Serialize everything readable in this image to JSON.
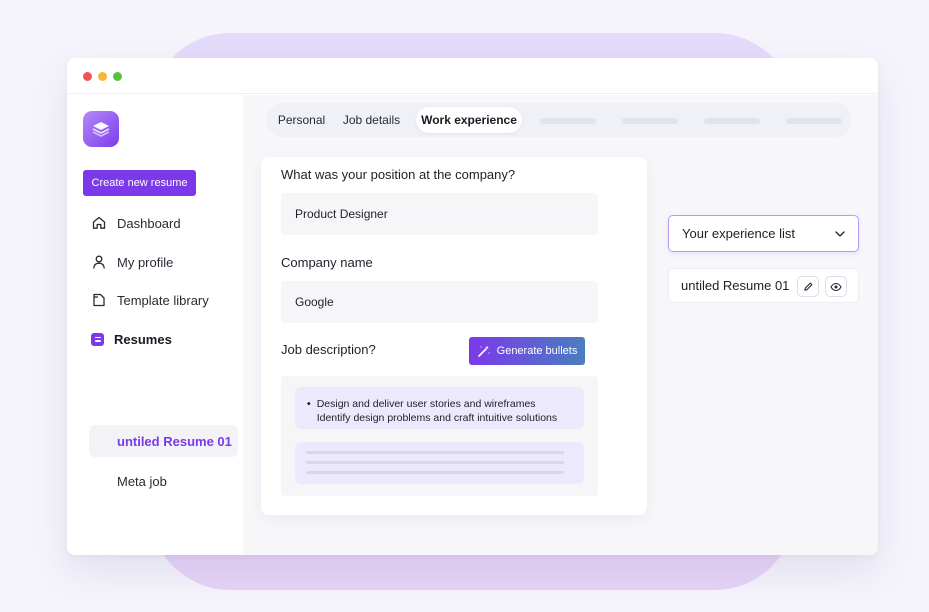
{
  "sidebar": {
    "logo_icon": "layers-icon",
    "create_label": "Create new resume",
    "items": [
      {
        "label": "Dashboard",
        "icon": "home-icon"
      },
      {
        "label": "My profile",
        "icon": "user-icon"
      },
      {
        "label": "Template library",
        "icon": "file-icon"
      },
      {
        "label": "Resumes",
        "icon": "resume-icon"
      }
    ],
    "resumes": [
      "untiled Resume 01",
      "Meta job"
    ]
  },
  "tabs": [
    "Personal",
    "Job details",
    "Work experience"
  ],
  "active_tab": "Work experience",
  "form": {
    "position_label": "What was your position at the company?",
    "position_value": "Product Designer",
    "company_label": "Company name",
    "company_value": "Google",
    "description_label": "Job description?",
    "generate_label": "Generate bullets",
    "bullet_text": "Design and deliver user stories and wireframes Identify design problems and craft intuitive solutions"
  },
  "experience": {
    "select_label": "Your experience list",
    "items": [
      "untiled Resume 01"
    ]
  },
  "colors": {
    "accent": "#7b39ea",
    "gradient_end": "#4a7ec0"
  }
}
